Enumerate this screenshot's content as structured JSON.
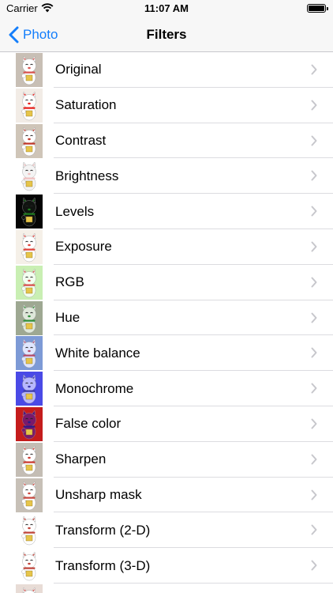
{
  "status_bar": {
    "carrier": "Carrier",
    "time": "11:07 AM"
  },
  "nav": {
    "back_label": "Photo",
    "title": "Filters"
  },
  "colors": {
    "accent": "#147efb"
  },
  "filters": [
    {
      "label": "Original",
      "bg": "#c8bfb5",
      "cat": "#ffffff",
      "accent": "#d9534f"
    },
    {
      "label": "Saturation",
      "bg": "#f2ece6",
      "cat": "#ffffff",
      "accent": "#e8211c"
    },
    {
      "label": "Contrast",
      "bg": "#cfc5b8",
      "cat": "#ffffff",
      "accent": "#c0392b"
    },
    {
      "label": "Brightness",
      "bg": "#ffffff",
      "cat": "#f4f4f4",
      "accent": "#f1c0c0"
    },
    {
      "label": "Levels",
      "bg": "#050505",
      "cat": "#101410",
      "accent": "#1f7a1f"
    },
    {
      "label": "Exposure",
      "bg": "#f5f0e8",
      "cat": "#ffffff",
      "accent": "#e0443c"
    },
    {
      "label": "RGB",
      "bg": "#c9efb3",
      "cat": "#f3fff0",
      "accent": "#d94f4f"
    },
    {
      "label": "Hue",
      "bg": "#9ea892",
      "cat": "#dfe8da",
      "accent": "#2f8f3a"
    },
    {
      "label": "White balance",
      "bg": "#7d9ad6",
      "cat": "#dfe6ff",
      "accent": "#b54a6a"
    },
    {
      "label": "Monochrome",
      "bg": "#4a4ae6",
      "cat": "#b8b8ff",
      "accent": "#3a3aa8"
    },
    {
      "label": "False color",
      "bg": "#c41c1c",
      "cat": "#7a1a6a",
      "accent": "#2a1a8a"
    },
    {
      "label": "Sharpen",
      "bg": "#c4bdb4",
      "cat": "#ffffff",
      "accent": "#cc3b32"
    },
    {
      "label": "Unsharp mask",
      "bg": "#c7c0b7",
      "cat": "#ffffff",
      "accent": "#c94a40"
    },
    {
      "label": "Transform (2-D)",
      "bg": "#ffffff",
      "cat": "#ffffff",
      "accent": "#c0453b"
    },
    {
      "label": "Transform (3-D)",
      "bg": "#ffffff",
      "cat": "#ffffff",
      "accent": "#c0453b"
    },
    {
      "label": "",
      "bg": "#e8dcd6",
      "cat": "#ffffff",
      "accent": "#d9534f"
    }
  ]
}
